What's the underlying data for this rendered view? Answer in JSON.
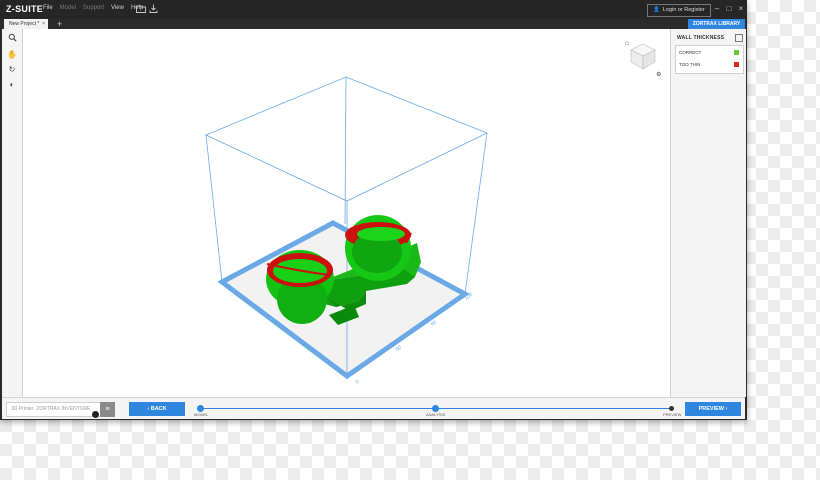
{
  "app": {
    "logo": "Z-SUITE",
    "menu": [
      {
        "label": "File",
        "dim": false
      },
      {
        "label": "Model",
        "dim": true
      },
      {
        "label": "Support",
        "dim": true
      },
      {
        "label": "View",
        "dim": false
      },
      {
        "label": "Help",
        "dim": false
      }
    ],
    "login_label": "Login or Register",
    "library_label": "ZORTRAX LIBRARY"
  },
  "tabs": [
    {
      "label": "New Project *"
    }
  ],
  "panel": {
    "title": "WALL THICKNESS",
    "legend": [
      {
        "label": "CORRECT",
        "color": "#66cc33"
      },
      {
        "label": "TOO THIN",
        "color": "#d62a1e"
      }
    ]
  },
  "viewport": {
    "axis_ticks": [
      "0",
      "60",
      "80",
      "100"
    ],
    "model_colors": {
      "ok": "#14c814",
      "thin": "#c81414"
    },
    "build_volume_color": "#6aa9e6"
  },
  "bottom": {
    "printer_label": "3D Printer",
    "printer_value": "ZORTRAX INVENTURE",
    "back_label": "BACK",
    "preview_label": "PREVIEW",
    "steps": [
      {
        "label": "MODEL",
        "done": true
      },
      {
        "label": "ANALYSIS",
        "done": true
      },
      {
        "label": "PREVIEW",
        "done": false
      }
    ]
  },
  "icons": {
    "toolbar": [
      "search-icon",
      "hand-icon",
      "rotate-icon",
      "view-icon"
    ],
    "top": [
      "folder-open-icon",
      "export-icon"
    ]
  }
}
